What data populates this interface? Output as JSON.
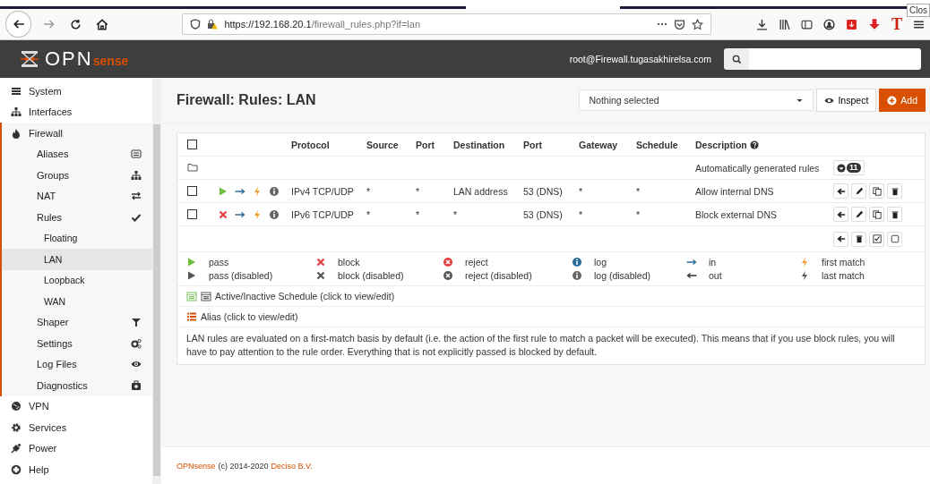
{
  "browser": {
    "url_host": "https://192.168.20.1",
    "url_path": "/firewall_rules.php?if=lan",
    "extension_label": "T",
    "tooltip": "Clos"
  },
  "header": {
    "logo_main": "OPN",
    "logo_suffix": "sense",
    "user": "root@Firewall.tugasakhirelsa.com"
  },
  "sidebar": {
    "items": [
      {
        "label": "System",
        "kind": "bars",
        "selected": false
      },
      {
        "label": "Interfaces",
        "kind": "sitemap",
        "selected": false
      },
      {
        "label": "Firewall",
        "kind": "fire",
        "selected": false,
        "expanded": true,
        "children": [
          {
            "label": "Aliases",
            "kind": "listalt",
            "selected": false
          },
          {
            "label": "Groups",
            "kind": "sitemap",
            "selected": false
          },
          {
            "label": "NAT",
            "kind": "exchange",
            "selected": false
          },
          {
            "label": "Rules",
            "kind": "check",
            "selected": false,
            "children": [
              {
                "label": "Floating",
                "selected": false
              },
              {
                "label": "LAN",
                "selected": true
              },
              {
                "label": "Loopback",
                "selected": false
              },
              {
                "label": "WAN",
                "selected": false
              }
            ]
          },
          {
            "label": "Shaper",
            "kind": "filter",
            "selected": false
          },
          {
            "label": "Settings",
            "kind": "cogs",
            "selected": false
          },
          {
            "label": "Log Files",
            "kind": "eye",
            "selected": false
          },
          {
            "label": "Diagnostics",
            "kind": "medkit",
            "selected": false
          }
        ]
      },
      {
        "label": "VPN",
        "kind": "globe",
        "selected": false
      },
      {
        "label": "Services",
        "kind": "gear",
        "selected": false
      },
      {
        "label": "Power",
        "kind": "plug",
        "selected": false
      },
      {
        "label": "Help",
        "kind": "lifebuoy",
        "selected": false
      }
    ]
  },
  "page": {
    "title": "Firewall: Rules: LAN",
    "select": "Nothing selected",
    "inspect_button": "Inspect",
    "add_button": "Add"
  },
  "table": {
    "header_checked": false,
    "columns": [
      "Protocol",
      "Source",
      "Port",
      "Destination",
      "Port",
      "Gateway",
      "Schedule",
      "Description"
    ],
    "group": {
      "description": "Automatically generated rules",
      "count": "11"
    },
    "rows": [
      {
        "checked": false,
        "kind": "pass",
        "log": false,
        "protocol": "IPv4 TCP/UDP",
        "source": "*",
        "source_port": "*",
        "destination": "LAN address",
        "destination_port": "53 (DNS)",
        "gateway": "*",
        "schedule": "*",
        "description": "Allow internal DNS"
      },
      {
        "checked": false,
        "kind": "block",
        "log": false,
        "protocol": "IPv6 TCP/UDP",
        "source": "*",
        "source_port": "*",
        "destination": "*",
        "destination_port": "53 (DNS)",
        "gateway": "*",
        "schedule": "*",
        "description": "Block external DNS"
      }
    ]
  },
  "legend": [
    {
      "kind": "pass",
      "label": "pass"
    },
    {
      "kind": "block",
      "label": "block"
    },
    {
      "kind": "reject",
      "label": "reject"
    },
    {
      "kind": "log",
      "label": "log"
    },
    {
      "kind": "in",
      "label": "in"
    },
    {
      "kind": "first",
      "label": "first match"
    },
    {
      "kind": "pass_disabled",
      "label": "pass (disabled)"
    },
    {
      "kind": "block_disabled",
      "label": "block (disabled)"
    },
    {
      "kind": "reject_disabled",
      "label": "reject (disabled)"
    },
    {
      "kind": "log_disabled",
      "label": "log (disabled)"
    },
    {
      "kind": "out",
      "label": "out"
    },
    {
      "kind": "last",
      "label": "last match"
    }
  ],
  "schedule_note": "Active/Inactive Schedule (click to view/edit)",
  "alias_note": "Alias (click to view/edit)",
  "info": "LAN rules are evaluated on a first-match basis by default (i.e. the action of the first rule to match a packet will be executed). This means that if you use block rules, you will have to pay attention to the rule order. Everything that is not explicitly passed is blocked by default.",
  "footer": {
    "brand": "OPNsense",
    "copyright": "(c) 2014-2020",
    "company": "Deciso B.V."
  }
}
